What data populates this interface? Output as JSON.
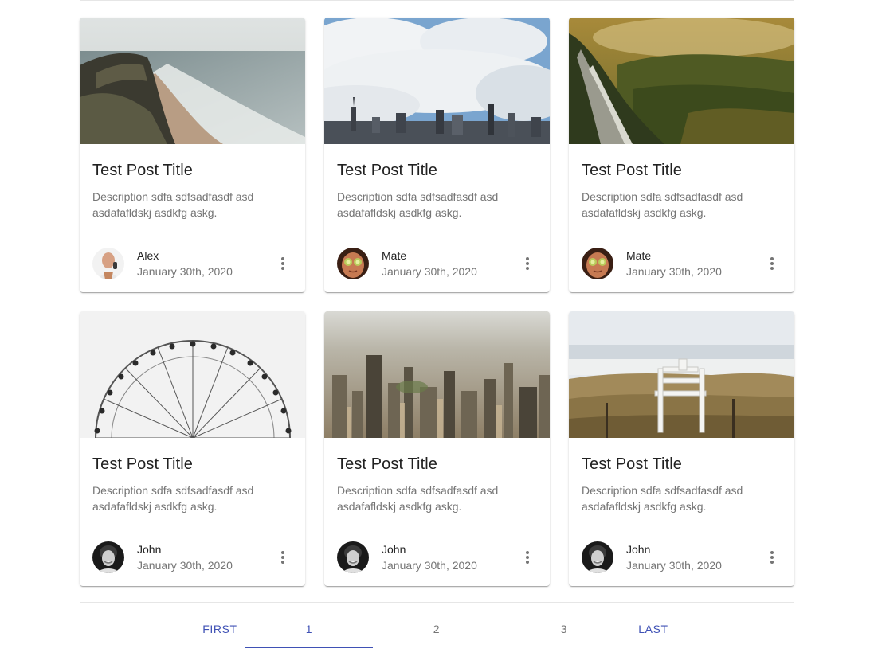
{
  "posts": [
    {
      "title": "Test Post Title",
      "description": "Description sdfa sdfsadfasdf asd asdafafldskj asdkfg askg.",
      "author": "Alex",
      "date": "January 30th, 2020",
      "image": "beach-cliff-image",
      "avatar": "alex-avatar"
    },
    {
      "title": "Test Post Title",
      "description": "Description sdfa sdfsadfasdf asd asdafafldskj asdkfg askg.",
      "author": "Mate",
      "date": "January 30th, 2020",
      "image": "city-clouds-image",
      "avatar": "mate-avatar"
    },
    {
      "title": "Test Post Title",
      "description": "Description sdfa sdfsadfasdf asd asdafafldskj asdkfg askg.",
      "author": "Mate",
      "date": "January 30th, 2020",
      "image": "forest-waterfall-image",
      "avatar": "mate-avatar"
    },
    {
      "title": "Test Post Title",
      "description": "Description sdfa sdfsadfasdf asd asdafafldskj asdkfg askg.",
      "author": "John",
      "date": "January 30th, 2020",
      "image": "ferris-wheel-image",
      "avatar": "john-avatar"
    },
    {
      "title": "Test Post Title",
      "description": "Description sdfa sdfsadfasdf asd asdafafldskj asdkfg askg.",
      "author": "John",
      "date": "January 30th, 2020",
      "image": "city-aerial-image",
      "avatar": "john-avatar"
    },
    {
      "title": "Test Post Title",
      "description": "Description sdfa sdfsadfasdf asd asdafafldskj asdkfg askg.",
      "author": "John",
      "date": "January 30th, 2020",
      "image": "lifeguard-chair-image",
      "avatar": "john-avatar"
    }
  ],
  "pagination": {
    "first": "FIRST",
    "pages": [
      "1",
      "2",
      "3"
    ],
    "last": "LAST",
    "active_page": "1"
  },
  "colors": {
    "accent": "#3f51b5",
    "title": "#212121",
    "muted": "#757575",
    "divider": "#e6e6e6"
  },
  "icons": {
    "more": "more-vert-icon"
  }
}
